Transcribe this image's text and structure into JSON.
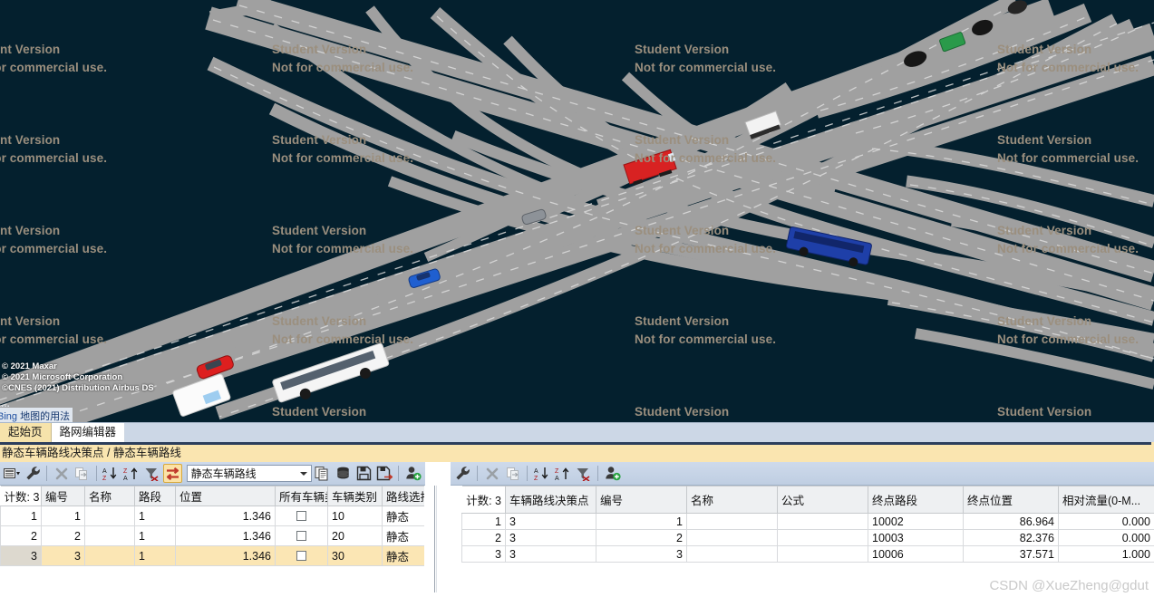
{
  "map": {
    "background_color": "#04202e",
    "road_color": "#a0a0a0",
    "watermark_line1": "Student Version",
    "watermark_line2": "Not for commercial use.",
    "watermark_color": "#9b8f7e",
    "copyright": [
      "© 2021 Maxar",
      "© 2021 Microsoft Corporation",
      "©CNES (2021) Distribution Airbus DS"
    ],
    "ellipsis": "…",
    "bing_link_prefix": "Bing ",
    "bing_link_text": "地图的用法",
    "vehicles": [
      {
        "name": "red-truck",
        "color": "#d82222"
      },
      {
        "name": "white-truck",
        "color": "#f2f2f2"
      },
      {
        "name": "blue-bus",
        "color": "#1e3fa8"
      },
      {
        "name": "blue-car",
        "color": "#1f5fd0"
      },
      {
        "name": "gray-car",
        "color": "#8d9298"
      },
      {
        "name": "red-car",
        "color": "#dd1f1f"
      },
      {
        "name": "white-bus",
        "color": "#f5f5f5"
      },
      {
        "name": "green-van",
        "color": "#2a9a4a"
      },
      {
        "name": "black-car-1",
        "color": "#161616"
      },
      {
        "name": "black-car-2",
        "color": "#161616"
      },
      {
        "name": "black-car-3",
        "color": "#252525"
      }
    ]
  },
  "tabs": [
    {
      "label": "起始页",
      "active": false
    },
    {
      "label": "路网编辑器",
      "active": true
    }
  ],
  "breadcrumb": "静态车辆路线决策点 / 静态车辆路线",
  "left_panel": {
    "toolbar": {
      "list_icon": "list-dropdown-icon",
      "wrench_icon": "wrench-icon",
      "delete_icon": "delete-x-icon",
      "duplicate_icon": "duplicate-icon",
      "sort_az_icon": "sort-az-icon",
      "sort_za_icon": "sort-za-icon",
      "filter_icon": "filter-clear-icon",
      "sync_icon": "sync-refresh-icon",
      "copy_icon": "copy-pages-icon",
      "database_icon": "database-icon",
      "save_icon": "save-icon",
      "save_as_icon": "save-as-icon",
      "add_user_icon": "add-user-icon",
      "combo_value": "静态车辆路线"
    },
    "grid": {
      "count_label": "计数: 3",
      "columns": [
        "编号",
        "名称",
        "路段",
        "位置",
        "所有车辆类型",
        "车辆类别",
        "路线选择方法"
      ],
      "rows": [
        {
          "n": "1",
          "cells": [
            "1",
            "",
            "1",
            "1.346",
            "checkbox",
            "10",
            "静态"
          ],
          "selected": false
        },
        {
          "n": "2",
          "cells": [
            "2",
            "",
            "1",
            "1.346",
            "checkbox",
            "20",
            "静态"
          ],
          "selected": false
        },
        {
          "n": "3",
          "cells": [
            "3",
            "",
            "1",
            "1.346",
            "checkbox",
            "30",
            "静态"
          ],
          "selected": true
        }
      ]
    }
  },
  "right_panel": {
    "toolbar": {
      "wrench_icon": "wrench-icon",
      "delete_icon": "delete-x-icon",
      "duplicate_icon": "duplicate-icon",
      "sort_az_icon": "sort-az-icon",
      "sort_za_icon": "sort-za-icon",
      "filter_icon": "filter-clear-icon",
      "add_user_icon": "add-user-icon"
    },
    "grid": {
      "count_label": "计数: 3",
      "columns": [
        "车辆路线决策点",
        "编号",
        "名称",
        "公式",
        "终点路段",
        "终点位置",
        "相对流量(0-M..."
      ],
      "rows": [
        {
          "n": "1",
          "cells": [
            "3",
            "1",
            "",
            "hatch",
            "10002",
            "86.964",
            "0.000"
          ]
        },
        {
          "n": "2",
          "cells": [
            "3",
            "2",
            "",
            "hatch",
            "10003",
            "82.376",
            "0.000"
          ]
        },
        {
          "n": "3",
          "cells": [
            "3",
            "3",
            "",
            "hatch",
            "10006",
            "37.571",
            "1.000"
          ]
        }
      ]
    }
  },
  "watermark_csdn": "CSDN @XueZheng@gdut"
}
